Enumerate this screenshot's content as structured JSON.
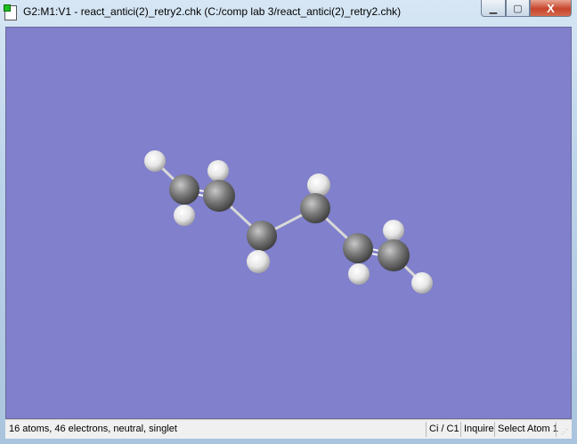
{
  "window": {
    "title": "G2:M1:V1 - react_antici(2)_retry2.chk (C:/comp lab 3/react_antici(2)_retry2.chk)",
    "controls": {
      "minimize": "▁",
      "maximize": "▢",
      "close": "X"
    }
  },
  "molecule": {
    "atom_colors": {
      "carbon": "#808080",
      "hydrogen": "#ffffff"
    },
    "background": "#8080cc"
  },
  "statusbar": {
    "summary": "16 atoms, 46 electrons, neutral, singlet",
    "symmetry": "Ci / C1",
    "mode": "Inquire",
    "action": "Select Atom 1"
  }
}
